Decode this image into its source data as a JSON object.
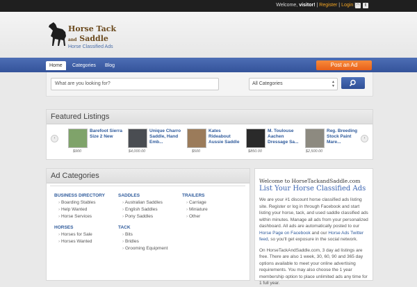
{
  "topbar": {
    "welcome": "Welcome,",
    "user": "visitor!",
    "register": "Register",
    "sep": "|",
    "login": "Login"
  },
  "header": {
    "logo_line1": "Horse Tack",
    "logo_and": "and",
    "logo_line2": "Saddle",
    "tagline": "Horse Classified Ads"
  },
  "nav": {
    "home": "Home",
    "categories": "Categories",
    "blog": "Blog",
    "post_ad": "Post an Ad"
  },
  "search": {
    "placeholder": "What are you looking for?",
    "category_selected": "All Categories"
  },
  "featured": {
    "title": "Featured Listings",
    "items": [
      {
        "title": "Barefoot Sierra Size 2 New",
        "price": "$900"
      },
      {
        "title": "Unique Charro Saddle, Hand Emb...",
        "price": "$4,000.00"
      },
      {
        "title": "Kates Rideabout Aussie Saddle",
        "price": "$500"
      },
      {
        "title": "M. Toulouse Aachen Dressage Sa...",
        "price": "$850.00"
      },
      {
        "title": "Reg. Breeding Stock Paint Mare...",
        "price": "$2,500.00"
      }
    ]
  },
  "ad_categories": {
    "title": "Ad Categories",
    "groups": [
      {
        "name": "BUSINESS DIRECTORY",
        "items": [
          "Boarding Stables",
          "Help Wanted",
          "Horse Services"
        ]
      },
      {
        "name": "HORSES",
        "items": [
          "Horses for Sale",
          "Horses Wanted"
        ]
      },
      {
        "name": "SADDLES",
        "items": [
          "Australian Saddles",
          "English Saddles",
          "Pony Saddles"
        ]
      },
      {
        "name": "TACK",
        "items": [
          "Bits",
          "Bridles",
          "Grooming Equipment"
        ]
      },
      {
        "name": "TRAILERS",
        "items": [
          "Carriage",
          "Miniature",
          "Other"
        ]
      }
    ]
  },
  "welcome": {
    "title": "Welcome to HorseTackandSaddle.com",
    "headline": "List Your Horse Classified Ads",
    "p1_a": "We are your #1 discount horse classified ads listing site. Register or log in through Facebook and start listing your horse, tack, and used saddle classified ads within minutes. Manage all ads from your personalized dashboard. All ads are automatically posted to our ",
    "p1_link1": "Horse Page on Facebook",
    "p1_b": " and our ",
    "p1_link2": "Horse Ads Twitter feed",
    "p1_c": ", so you'll get exposure in the social network.",
    "p2": "On HorseTackAndSaddle.com, 3 day ad listings are free. There are also 1 week, 30, 60, 90 and 365 day options available to meet your online advertising requirements. You may also choose the 1 year membership option to place unlimited ads any time for 1 full year."
  },
  "colors": {
    "nav_blue": "#3b5ba5",
    "post_ad_orange": "#f07a2e",
    "link_blue": "#2e5a9b",
    "logo_brown": "#6b4a1e"
  }
}
